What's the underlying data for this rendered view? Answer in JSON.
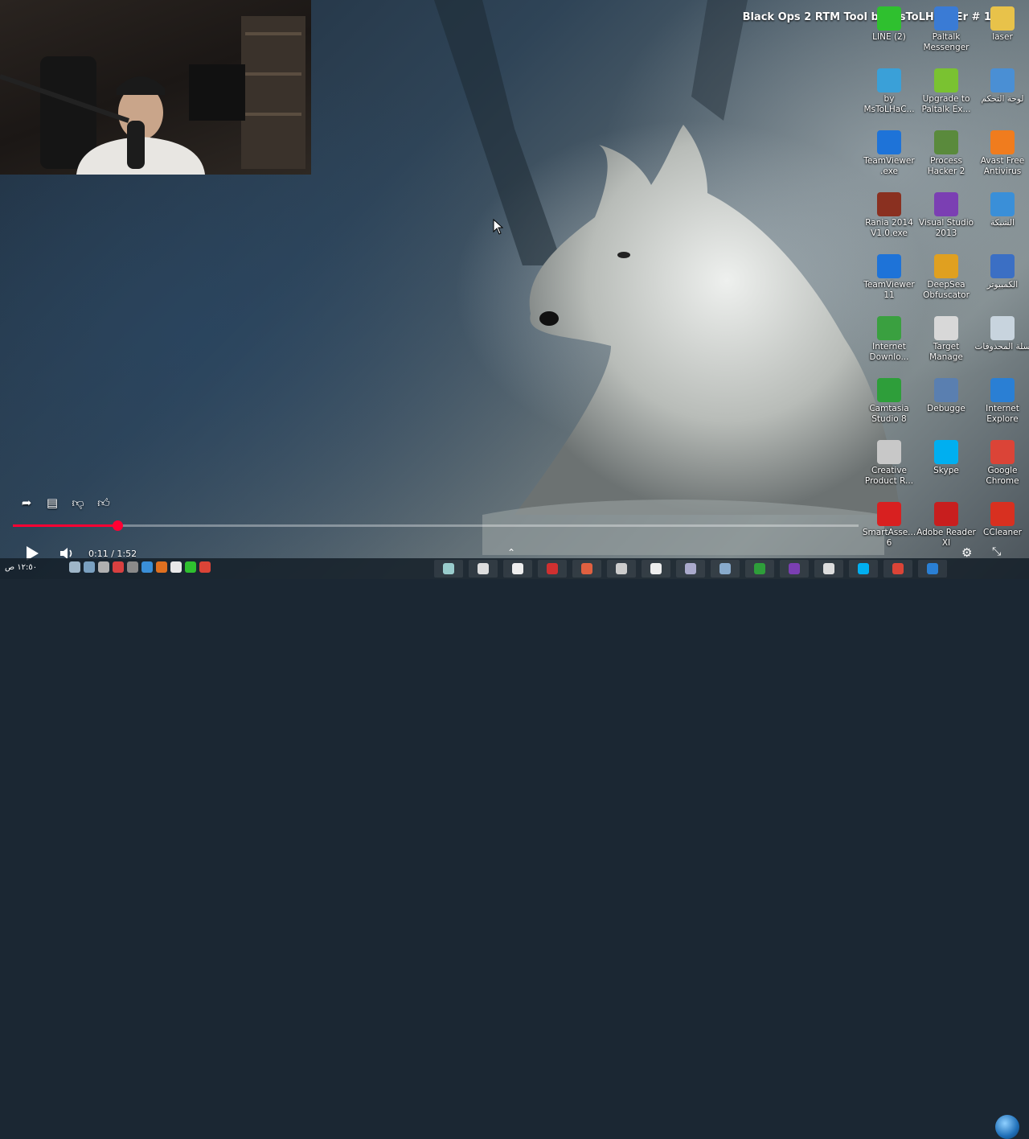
{
  "video": {
    "title": "Black Ops 2 RTM Tool by MsToLHaCkEr # 1.19",
    "current_time": "0:11",
    "separator": " / ",
    "duration": "1:52",
    "progress_fraction": 0.124
  },
  "taskbar": {
    "clock": "١٢:٥٠ ص"
  },
  "desktop_icons": [
    {
      "label": "LINE (2)",
      "icon": "line-icon",
      "color": "#2fc02f"
    },
    {
      "label": "Paltalk Messenger",
      "icon": "paltalk-icon",
      "color": "#3a7bd5"
    },
    {
      "label": "laser",
      "icon": "folder-icon",
      "color": "#e8c24a"
    },
    {
      "label": "by MsToLHaC...",
      "icon": "arduino-icon",
      "color": "#3aa0d8"
    },
    {
      "label": "Upgrade to Paltalk Ex...",
      "icon": "paltalk-upgrade-icon",
      "color": "#7ac231"
    },
    {
      "label": "لوحة التحكم",
      "icon": "control-panel-icon",
      "color": "#4a8fd4"
    },
    {
      "label": "TeamViewer .exe",
      "icon": "teamviewer-icon",
      "color": "#1e73d8"
    },
    {
      "label": "Process Hacker 2",
      "icon": "process-hacker-icon",
      "color": "#5a8a3c"
    },
    {
      "label": "Avast Free Antivirus",
      "icon": "avast-icon",
      "color": "#f07c1e"
    },
    {
      "label": "Rania 2014 V1.0.exe",
      "icon": "app-icon",
      "color": "#8a3020"
    },
    {
      "label": "Visual Studio 2013",
      "icon": "visual-studio-icon",
      "color": "#7b3fb3"
    },
    {
      "label": "الشبكة",
      "icon": "network-icon",
      "color": "#3a8fd8"
    },
    {
      "label": "TeamViewer 11",
      "icon": "teamviewer-icon",
      "color": "#1e73d8"
    },
    {
      "label": "DeepSea Obfuscator",
      "icon": "deepsea-icon",
      "color": "#e0a020"
    },
    {
      "label": "الكمبيوتر",
      "icon": "computer-icon",
      "color": "#3b6fc4"
    },
    {
      "label": "Internet Downlo...",
      "icon": "idm-icon",
      "color": "#3aa040"
    },
    {
      "label": "Target Manage",
      "icon": "document-icon",
      "color": "#d8d8d8"
    },
    {
      "label": "سلة المحذوفات",
      "icon": "recycle-bin-icon",
      "color": "#c8d4de"
    },
    {
      "label": "Camtasia Studio 8",
      "icon": "camtasia-icon",
      "color": "#2e9e3a"
    },
    {
      "label": "Debugge",
      "icon": "debugger-icon",
      "color": "#5a7fb0"
    },
    {
      "label": "Internet Explore",
      "icon": "internet-explorer-icon",
      "color": "#2a7fd4"
    },
    {
      "label": "Creative Product R...",
      "icon": "creative-icon",
      "color": "#c8c8c8"
    },
    {
      "label": "Skype",
      "icon": "skype-icon",
      "color": "#00aff0"
    },
    {
      "label": "Google Chrome",
      "icon": "chrome-icon",
      "color": "#db4437"
    },
    {
      "label": "SmartAsse... 6",
      "icon": "smartassembly-icon",
      "color": "#d82020"
    },
    {
      "label": "Adobe Reader XI",
      "icon": "adobe-reader-icon",
      "color": "#c81e1e"
    },
    {
      "label": "CCleaner",
      "icon": "ccleaner-icon",
      "color": "#d83020"
    }
  ],
  "colors": {
    "progress": "#ff0033"
  }
}
